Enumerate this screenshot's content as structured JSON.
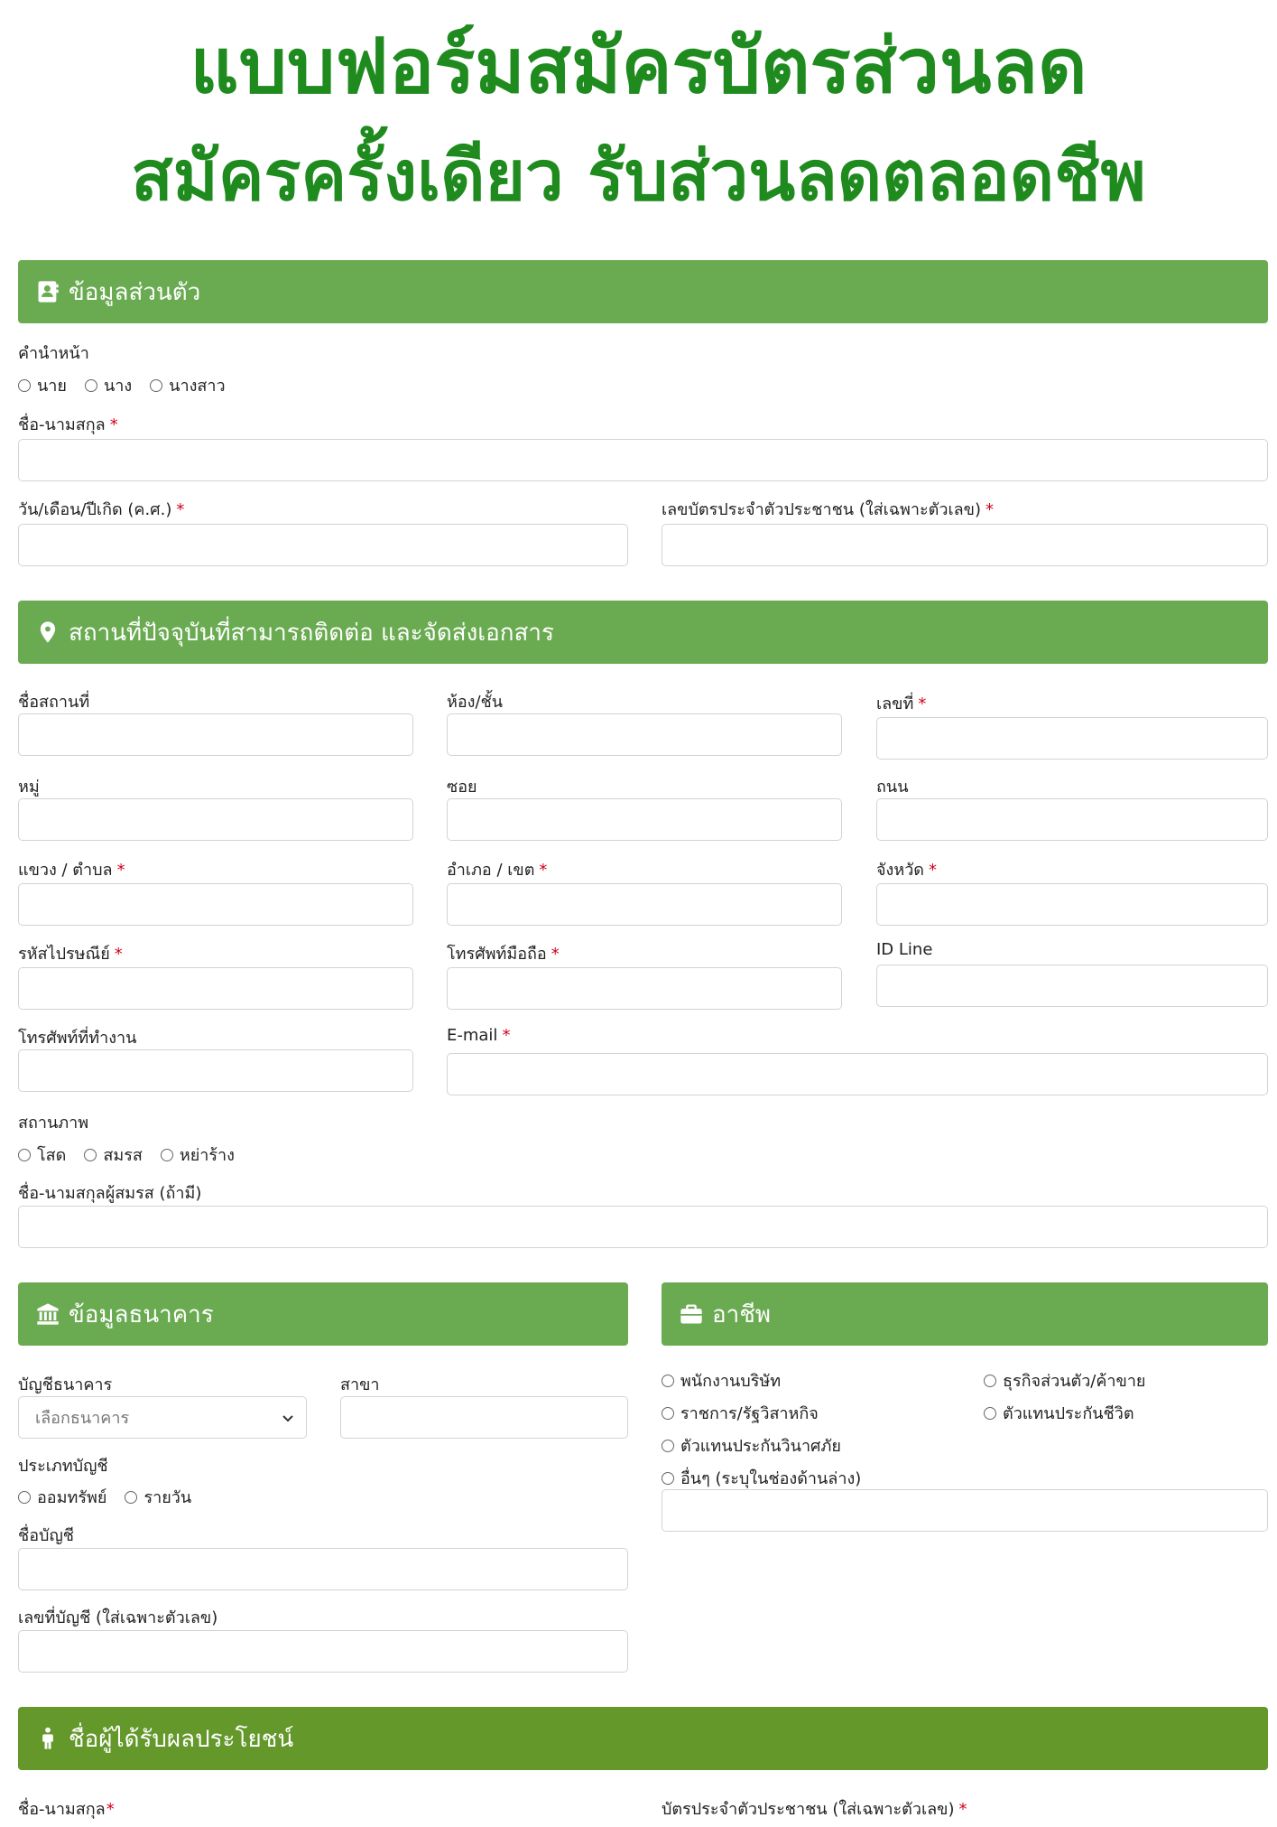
{
  "hero": {
    "line1": "แบบฟอร์มสมัครบัตรส่วนลด",
    "line2": "สมัครครั้งเดียว รับส่วนลดตลอดชีพ"
  },
  "colors": {
    "hero_green": "#1f8b1f",
    "section_green": "#6aab52",
    "section_green_dark": "#64982b",
    "required": "#d0021b"
  },
  "personal": {
    "heading": "ข้อมูลส่วนตัว",
    "heading_icon": "address-book-icon",
    "title_label": "คำนำหน้า",
    "title_options": [
      "นาย",
      "นาง",
      "นางสาว"
    ],
    "fullname_label": "ชื่อ-นามสกุล",
    "birthdate_label": "วัน/เดือน/ปีเกิด (ค.ศ.)",
    "idcard_label": "เลขบัตรประจำตัวประชาชน (ใส่เฉพาะตัวเลข)",
    "required_mark": "*"
  },
  "address": {
    "heading": "สถานที่ปัจจุบันที่สามารถติดต่อ และจัดส่งเอกสาร",
    "heading_icon": "map-marker-icon",
    "place_label": "ชื่อสถานที่",
    "room_label": "ห้อง/ชั้น",
    "number_label": "เลขที่",
    "moo_label": "หมู่",
    "soi_label": "ซอย",
    "road_label": "ถนน",
    "subdistrict_label": "แขวง / ตำบล",
    "district_label": "อำเภอ / เขต",
    "province_label": "จังหวัด",
    "postcode_label": "รหัสไปรษณีย์",
    "mobile_label": "โทรศัพท์มือถือ",
    "line_label": "ID Line",
    "worktel_label": "โทรศัพท์ที่ทำงาน",
    "email_label": "E-mail",
    "status_label": "สถานภาพ",
    "status_options": [
      "โสด",
      "สมรส",
      "หย่าร้าง"
    ],
    "spouse_label": "ชื่อ-นามสกุลผู้สมรส (ถ้ามี)"
  },
  "bank": {
    "heading": "ข้อมูลธนาคาร",
    "heading_icon": "bank-icon",
    "bank_label": "บัญชีธนาคาร",
    "bank_select_value": "เลือกธนาคาร",
    "branch_label": "สาขา",
    "type_label": "ประเภทบัญชี",
    "type_options": [
      "ออมทรัพย์",
      "รายวัน"
    ],
    "account_name_label": "ชื่อบัญชี",
    "account_no_label": "เลขที่บัญชี (ใส่เฉพาะตัวเลข)"
  },
  "career": {
    "heading": "อาชีพ",
    "heading_icon": "briefcase-icon",
    "options_left": [
      "พนักงานบริษัท",
      "ราชการ/รัฐวิสาหกิจ",
      "ตัวแทนประกันวินาศภัย",
      "อื่นๆ (ระบุในช่องด้านล่าง)"
    ],
    "options_right": [
      "ธุรกิจส่วนตัว/ค้าขาย",
      "ตัวแทนประกันชีวิต"
    ]
  },
  "beneficiary": {
    "heading": "ชื่อผู้ได้รับผลประโยชน์",
    "heading_icon": "person-icon",
    "fullname_label": "ชื่อ-นามสกุล",
    "idcard_label": "บัตรประจำตัวประชาชน (ใส่เฉพาะตัวเลข)"
  }
}
